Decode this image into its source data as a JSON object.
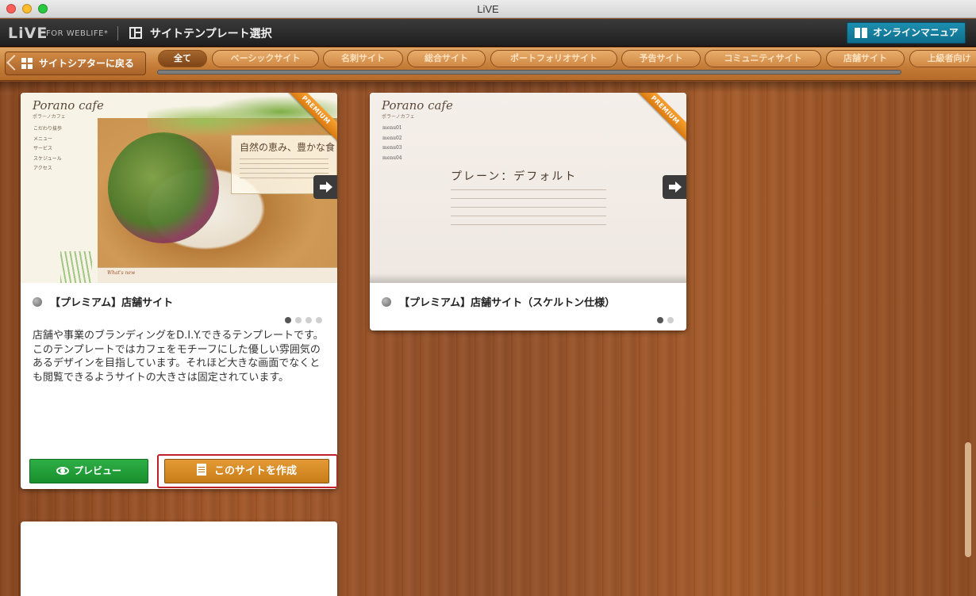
{
  "window": {
    "title": "LiVE"
  },
  "header": {
    "logo": "LiVE",
    "logo_sub": "FOR WEBLIFE*",
    "page_title": "サイトテンプレート選択",
    "manual_button": "オンラインマニュアル"
  },
  "tabbar": {
    "back_label": "サイトシアターに戻る",
    "tabs": [
      {
        "label": "全て",
        "active": true
      },
      {
        "label": "ベーシックサイト"
      },
      {
        "label": "名刺サイト"
      },
      {
        "label": "総合サイト"
      },
      {
        "label": "ポートフォリオサイト"
      },
      {
        "label": "予告サイト"
      },
      {
        "label": "コミュニティサイト"
      },
      {
        "label": "店舗サイト"
      },
      {
        "label": "上級者向け"
      }
    ]
  },
  "cards": [
    {
      "badge": "PREMIUM",
      "thumb": {
        "logo": "Porano cafe",
        "logo_sub": "ポラーノカフェ",
        "menu": [
          "こだわり抜歩",
          "メニュー",
          "サービス",
          "スケジュール",
          "アクセス"
        ],
        "tagline": "自然の恵み、豊かな食",
        "section": "What's new"
      },
      "title": "【プレミアム】店舗サイト",
      "dots": 4,
      "active_dot": 1,
      "description": "店舗や事業のブランディングをD.I.Y.できるテンプレートです。このテンプレートではカフェをモチーフにした優しい雰囲気のあるデザインを目指しています。それほど大きな画面でなくとも閲覧できるようサイトの大きさは固定されています。",
      "preview_button": "プレビュー",
      "create_button": "このサイトを作成"
    },
    {
      "badge": "PREMIUM",
      "thumb": {
        "logo": "Porano cafe",
        "logo_sub": "ポラーノカフェ",
        "menu": [
          "menu01",
          "menu02",
          "menu03",
          "menu04"
        ],
        "heading": "プレーン：デフォルト"
      },
      "title": "【プレミアム】店舗サイト（スケルトン仕様）",
      "dots": 2,
      "active_dot": 1
    }
  ],
  "colors": {
    "accent_teal": "#1d8fb0",
    "preview_green": "#17902d",
    "create_orange": "#c97c18",
    "highlight_red": "#c0202a",
    "ribbon_orange": "#f7a131"
  }
}
